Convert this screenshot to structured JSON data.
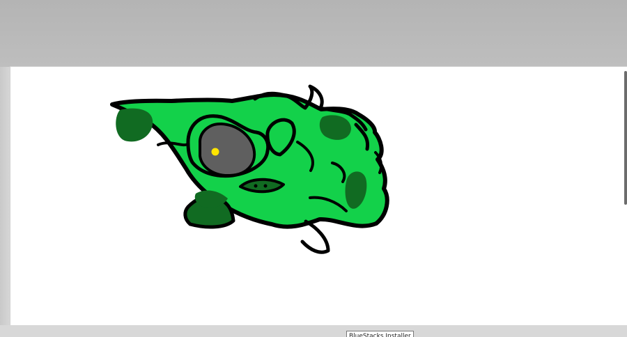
{
  "window": {
    "tooltip_text": "BlueStacks Installer"
  },
  "colors": {
    "background": "#bdbdbd",
    "canvas": "#ffffff",
    "bright_green": "#13d14a",
    "dark_green": "#116b22",
    "eye_gray": "#5f5f5f",
    "eye_yellow": "#ffe500",
    "outline": "#000000"
  },
  "canvas": {
    "content": "green frog drawing"
  }
}
